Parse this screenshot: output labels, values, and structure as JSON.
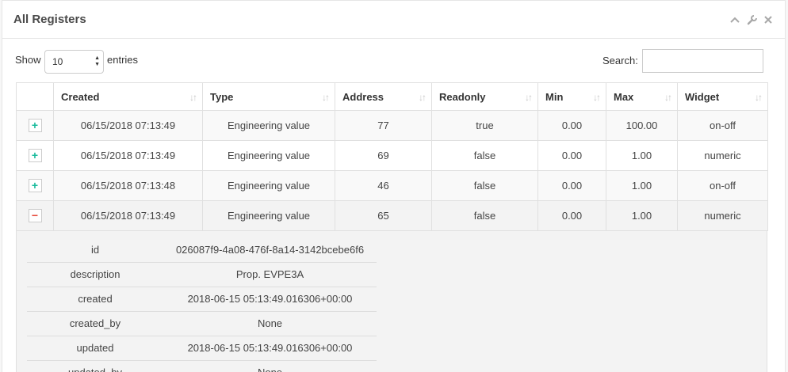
{
  "panel": {
    "title": "All Registers",
    "tools": [
      "chevron-up-icon",
      "wrench-icon",
      "close-icon"
    ]
  },
  "length": {
    "show_label": "Show",
    "value": "10",
    "entries_label": "entries"
  },
  "search": {
    "label": "Search:",
    "value": ""
  },
  "table": {
    "columns": [
      {
        "label": ""
      },
      {
        "label": "Created"
      },
      {
        "label": "Type"
      },
      {
        "label": "Address"
      },
      {
        "label": "Readonly"
      },
      {
        "label": "Min"
      },
      {
        "label": "Max"
      },
      {
        "label": "Widget"
      }
    ],
    "rows": [
      {
        "toggle": "+",
        "created": "06/15/2018 07:13:49",
        "type": "Engineering value",
        "address": "77",
        "readonly": "true",
        "min": "0.00",
        "max": "100.00",
        "widget": "on-off"
      },
      {
        "toggle": "+",
        "created": "06/15/2018 07:13:49",
        "type": "Engineering value",
        "address": "69",
        "readonly": "false",
        "min": "0.00",
        "max": "1.00",
        "widget": "numeric"
      },
      {
        "toggle": "+",
        "created": "06/15/2018 07:13:48",
        "type": "Engineering value",
        "address": "46",
        "readonly": "false",
        "min": "0.00",
        "max": "1.00",
        "widget": "on-off"
      },
      {
        "toggle": "−",
        "created": "06/15/2018 07:13:49",
        "type": "Engineering value",
        "address": "65",
        "readonly": "false",
        "min": "0.00",
        "max": "1.00",
        "widget": "numeric"
      }
    ]
  },
  "detail": {
    "rows": [
      {
        "key": "id",
        "value": "026087f9-4a08-476f-8a14-3142bcebe6f6"
      },
      {
        "key": "description",
        "value": "Prop. EVPE3A"
      },
      {
        "key": "created",
        "value": "2018-06-15 05:13:49.016306+00:00"
      },
      {
        "key": "created_by",
        "value": "None"
      },
      {
        "key": "updated",
        "value": "2018-06-15 05:13:49.016306+00:00"
      },
      {
        "key": "updated_by",
        "value": "None"
      }
    ]
  },
  "colors": {
    "accent": "#1abb9c",
    "danger": "#e74c3c"
  }
}
